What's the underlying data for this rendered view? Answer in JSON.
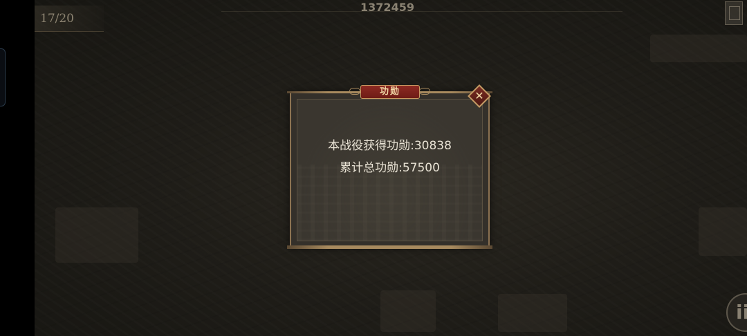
{
  "hud": {
    "counter": "17/20",
    "score": "1372459"
  },
  "dialog": {
    "title": "功勋",
    "close_symbol": "✕",
    "line1": "本战役获得功勋:30838",
    "line2": "累计总功勋:57500"
  },
  "icons": {
    "close": "close-icon",
    "corner": "map-icon",
    "round_button": "info-icon"
  }
}
